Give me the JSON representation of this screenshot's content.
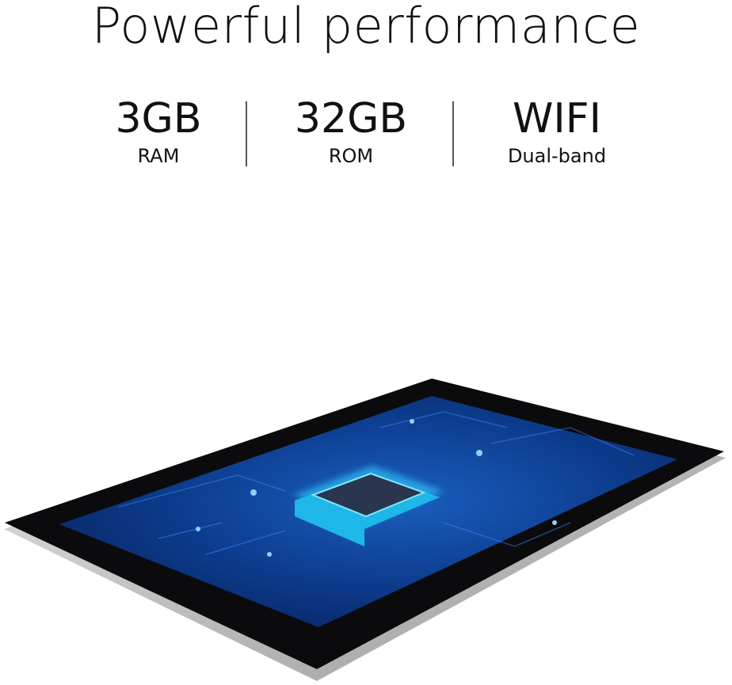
{
  "title": "Powerful performance",
  "specs": [
    {
      "value": "3GB",
      "label": "RAM"
    },
    {
      "value": "32GB",
      "label": "ROM"
    },
    {
      "value": "WIFI",
      "label": "Dual-band"
    }
  ]
}
